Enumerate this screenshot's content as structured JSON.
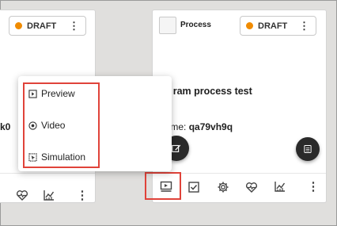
{
  "left_panel": {
    "status": {
      "label": "DRAFT",
      "color": "#f08b00"
    },
    "truncated_text": "k0",
    "toolbar": [
      {
        "icon": "health-heart-icon"
      },
      {
        "icon": "analytics-chart-icon"
      },
      {
        "icon": "more-vertical-icon"
      }
    ]
  },
  "right_panel": {
    "process_label": "Process",
    "status": {
      "label": "DRAFT",
      "color": "#f08b00"
    },
    "description": "Th    ram process test",
    "name_label": "Name:",
    "name_value": "qa79vh9q",
    "toolbar": [
      {
        "icon": "preview-icon",
        "highlighted": true
      },
      {
        "icon": "checkbox-icon"
      },
      {
        "icon": "settings-gear-icon"
      },
      {
        "icon": "health-heart-icon"
      },
      {
        "icon": "analytics-chart-icon"
      },
      {
        "icon": "more-vertical-icon"
      }
    ]
  },
  "menu": {
    "items": [
      {
        "label": "Preview",
        "icon": "preview-icon"
      },
      {
        "label": "Video",
        "icon": "play-circle-icon"
      },
      {
        "label": "Simulation",
        "icon": "simulation-icon"
      }
    ]
  },
  "colors": {
    "accent": "#f08b00",
    "highlight": "#e0433a",
    "fab": "#2a2a2a"
  }
}
